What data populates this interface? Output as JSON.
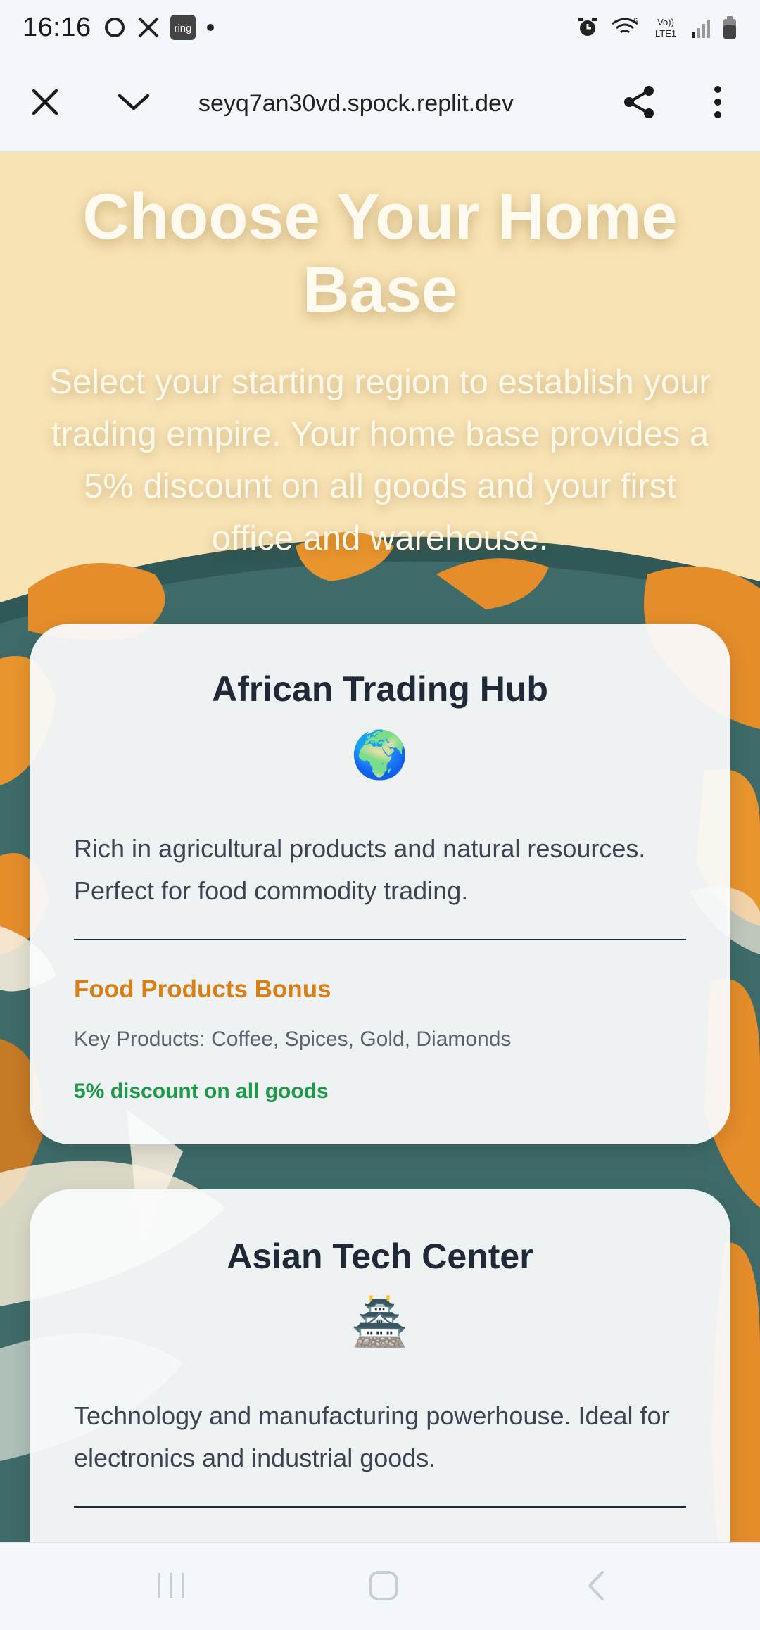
{
  "status_bar": {
    "time": "16:16",
    "app_badge": "ring",
    "network_label_top": "Vo))",
    "network_label_bottom": "LTE1",
    "wifi_label": "6",
    "icons_left": [
      "threads-icon",
      "x-icon",
      "ring-app-icon",
      "dot-icon"
    ],
    "icons_right": [
      "alarm-icon",
      "wifi-icon",
      "lte-icon",
      "signal-icon",
      "battery-icon"
    ]
  },
  "browser": {
    "url": "seyq7an30vd.spock.replit.dev",
    "icons": [
      "close-icon",
      "chevron-down-icon",
      "share-icon",
      "more-vert-icon"
    ]
  },
  "page": {
    "headline": "Choose Your Home Base",
    "subtitle": "Select your starting region to establish your trading empire. Your home base provides a 5% discount on all goods and your first office and warehouse."
  },
  "cards": [
    {
      "title": "African Trading Hub",
      "emoji": "🌍",
      "description": "Rich in agricultural products and natural resources. Perfect for food commodity trading.",
      "bonus": "Food Products Bonus",
      "key_products": "Key Products: Coffee, Spices, Gold, Diamonds",
      "discount": "5% discount on all goods"
    },
    {
      "title": "Asian Tech Center",
      "emoji": "🏯",
      "description": "Technology and manufacturing powerhouse. Ideal for electronics and industrial goods."
    }
  ],
  "colors": {
    "background_sand": "#f8e3b4",
    "ocean_teal": "#3e6b69",
    "land_orange": "#e48d2a",
    "bonus_orange": "#d97f15",
    "discount_green": "#1e9a4a"
  },
  "nav_bar": {
    "icons": [
      "recent-apps-icon",
      "home-icon",
      "back-icon"
    ]
  }
}
